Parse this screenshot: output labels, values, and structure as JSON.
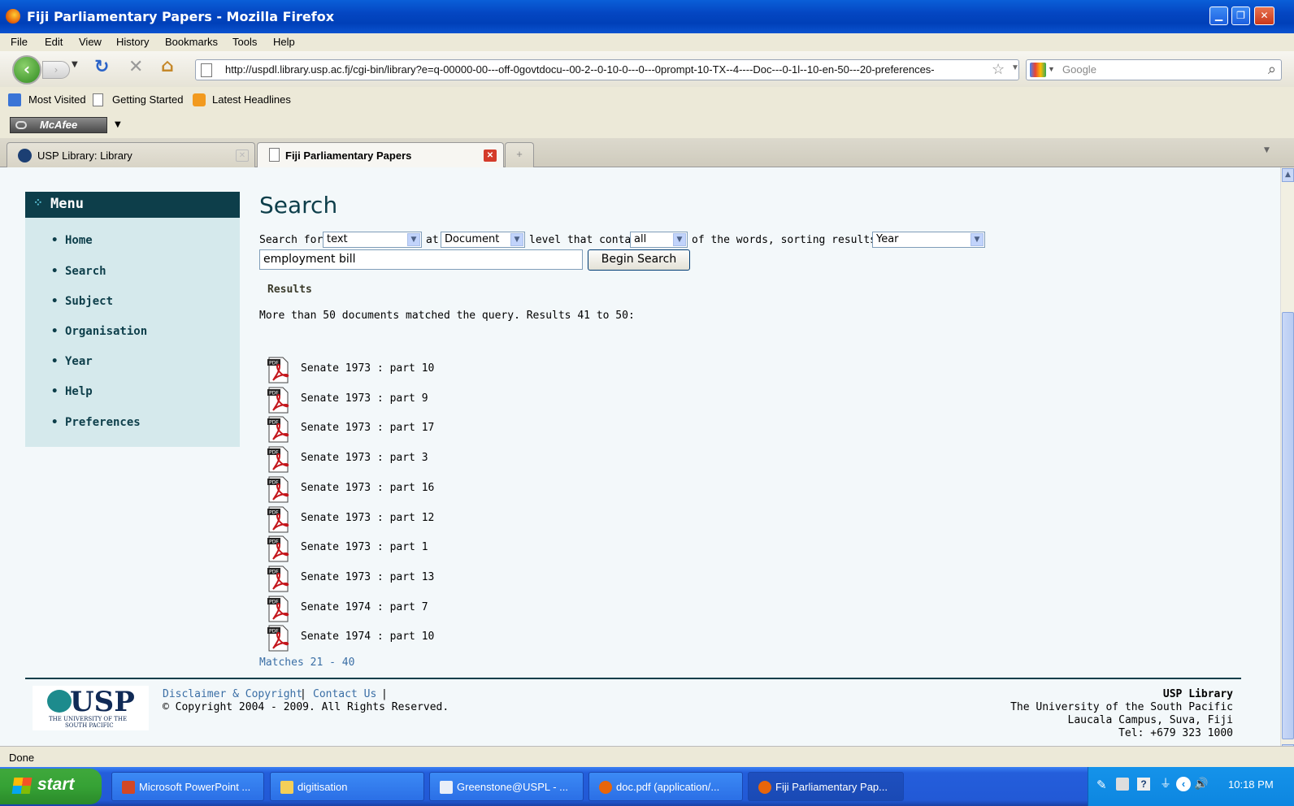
{
  "window": {
    "title": "Fiji Parliamentary Papers - Mozilla Firefox",
    "min": "▁",
    "max": "❐",
    "close": "✕"
  },
  "menubar": [
    "File",
    "Edit",
    "View",
    "History",
    "Bookmarks",
    "Tools",
    "Help"
  ],
  "nav": {
    "url": "http://uspdl.library.usp.ac.fj/cgi-bin/library?e=q-00000-00---off-0govtdocu--00-2--0-10-0---0---0prompt-10-TX--4----Doc---0-1l--10-en-50---20-preferences-",
    "search_placeholder": "Google"
  },
  "bookmarks": [
    "Most Visited",
    "Getting Started",
    "Latest Headlines"
  ],
  "mcafee": "McAfee",
  "tabs": [
    {
      "label": "USP Library: Library"
    },
    {
      "label": "Fiji Parliamentary Papers"
    }
  ],
  "sidebar": {
    "title": "Menu",
    "items": [
      "Home",
      "Search",
      "Subject",
      "Organisation",
      "Year",
      "Help",
      "Preferences"
    ]
  },
  "search": {
    "heading": "Search",
    "search_for_label": "Search for",
    "search_for_value": "text",
    "at_label": "at",
    "level_value": "Document",
    "level_label": "level that contain",
    "contain_value": "all",
    "sort_label": "of the words, sorting results by",
    "sort_value": "Year",
    "query": "employment bill",
    "button": "Begin Search"
  },
  "results": {
    "heading": "Results",
    "summary": "More than 50 documents matched the query. Results 41 to 50:",
    "items": [
      "Senate 1973 : part 10",
      "Senate 1973 : part 9",
      "Senate 1973 : part 17",
      "Senate 1973 : part 3",
      "Senate 1973 : part 16",
      "Senate 1973 : part 12",
      "Senate 1973 : part 1",
      "Senate 1973 : part 13",
      "Senate 1974 : part 7",
      "Senate 1974 : part 10"
    ],
    "prev_link": "Matches 21 - 40"
  },
  "footer": {
    "logo_text": "USP",
    "logo_sub1": "THE UNIVERSITY OF THE",
    "logo_sub2": "SOUTH PACIFIC",
    "disclaimer": "Disclaimer & Copyright",
    "sep1": "|",
    "contact": "Contact Us",
    "sep2": "|",
    "copyright": "© Copyright 2004 - 2009. All Rights Reserved.",
    "org": "USP Library",
    "line1": "The University of the South Pacific",
    "line2": "Laucala Campus, Suva, Fiji",
    "line3": "Tel: +679 323 1000"
  },
  "status": "Done",
  "taskbar": {
    "start": "start",
    "tasks": [
      "Microsoft PowerPoint ...",
      "digitisation",
      "Greenstone@USPL - ...",
      "doc.pdf (application/...",
      "Fiji Parliamentary Pap..."
    ],
    "clock": "10:18 PM"
  }
}
